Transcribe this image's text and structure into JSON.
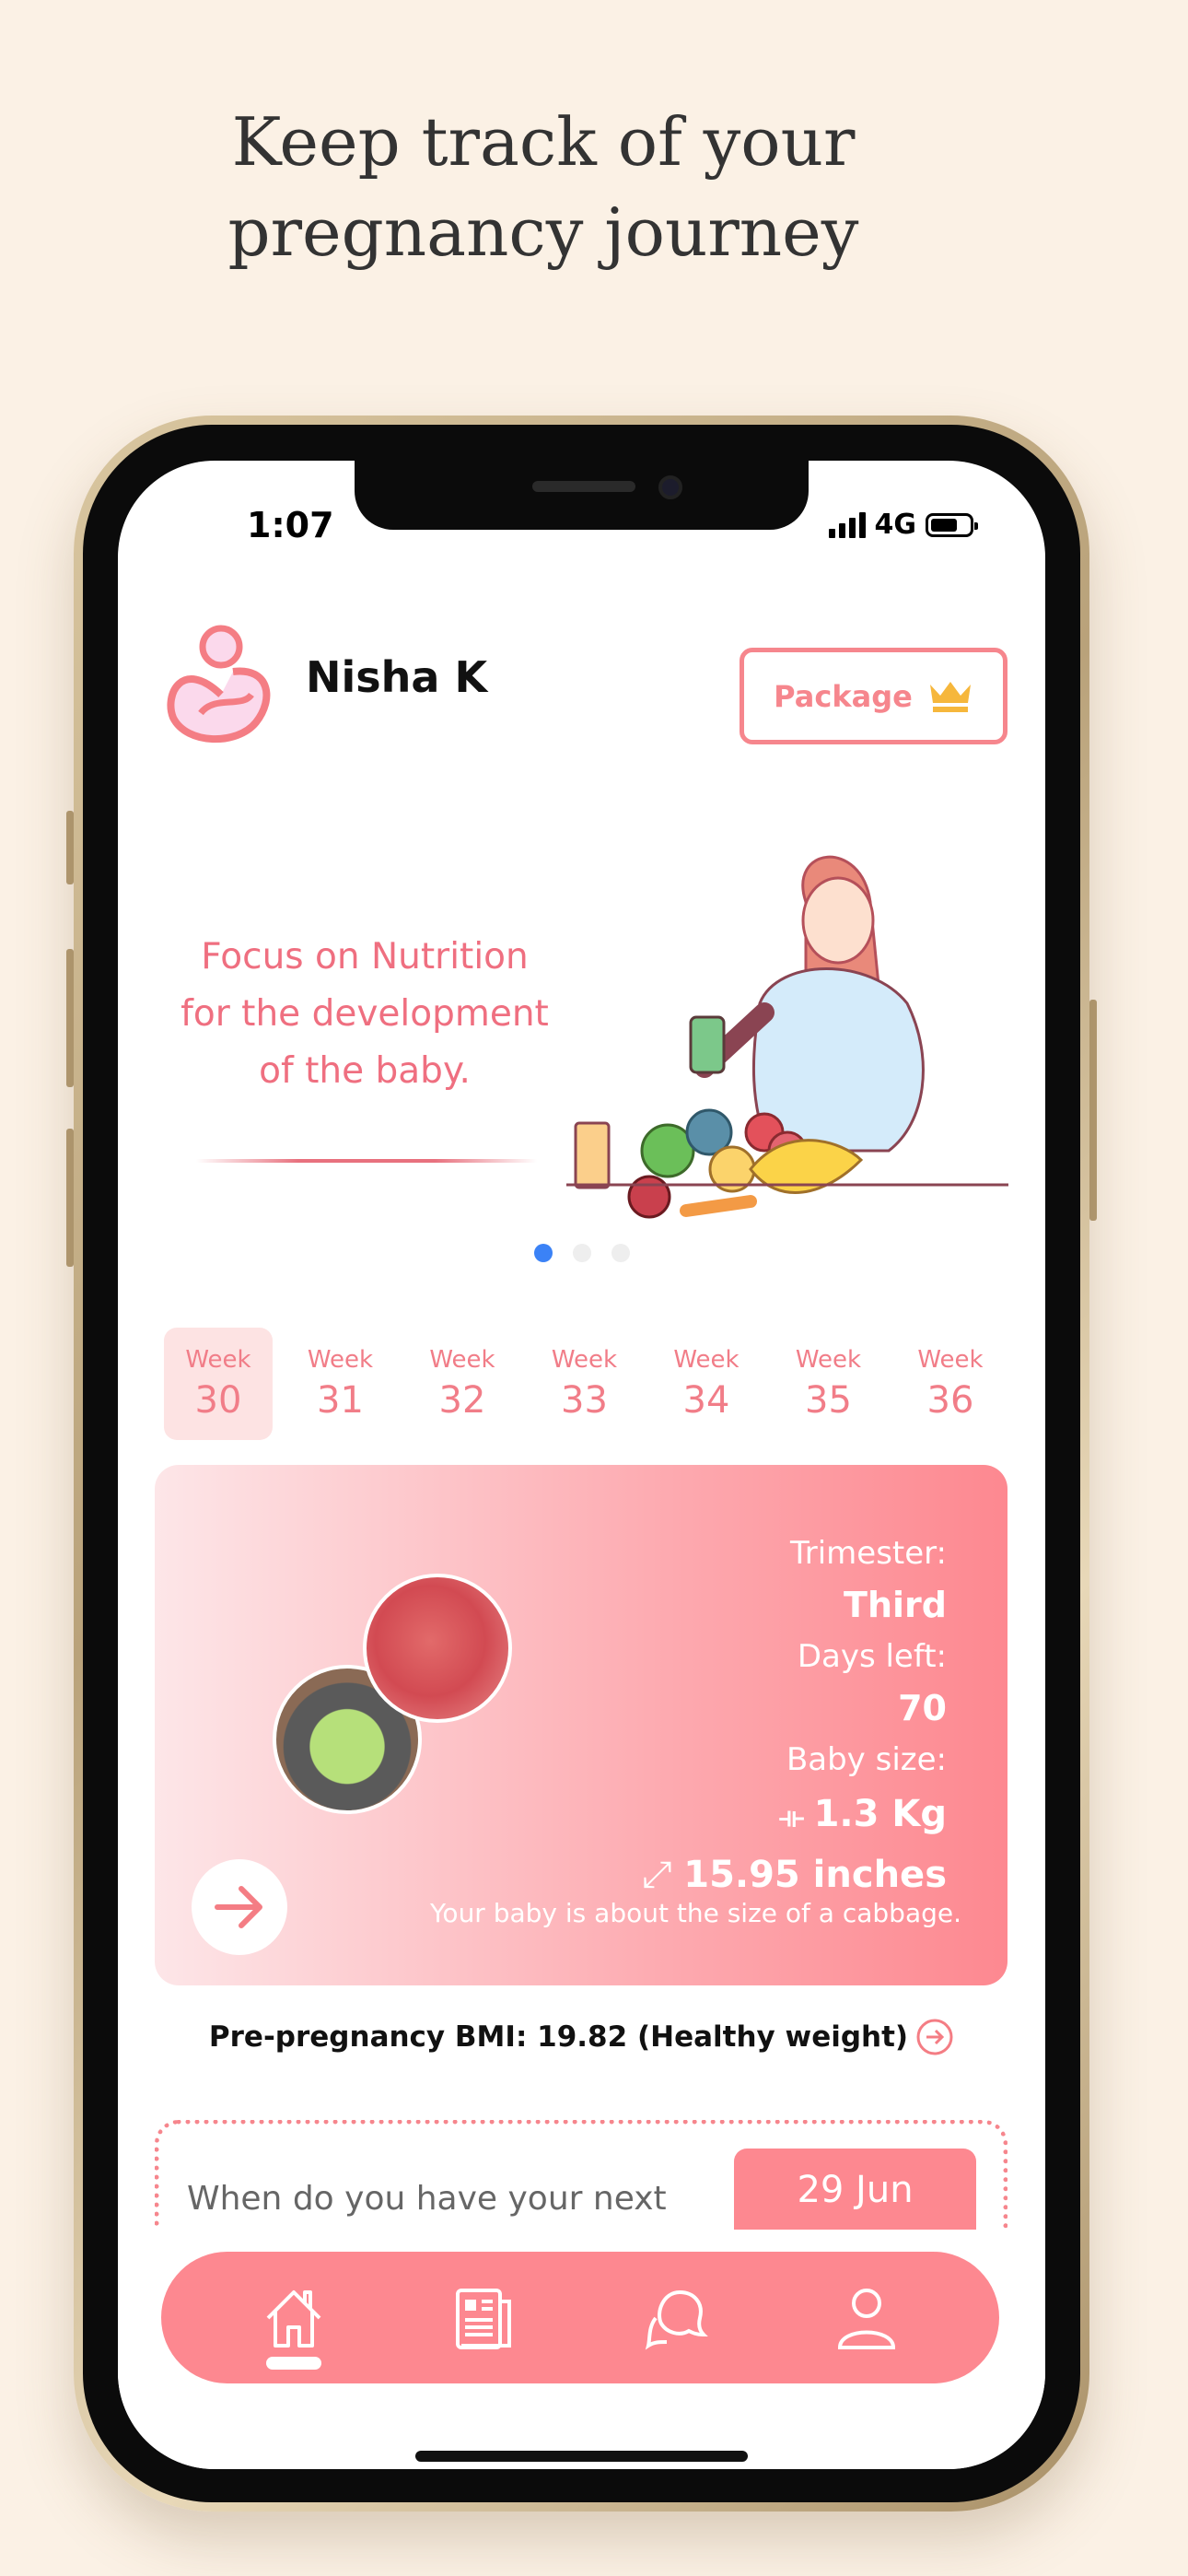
{
  "headline": [
    "Keep track of your",
    "pregnancy journey"
  ],
  "status_bar": {
    "time": "1:07",
    "network": "4G"
  },
  "header": {
    "username": "Nisha K",
    "package_label": "Package"
  },
  "banner": {
    "text": "Focus on Nutrition for the development of the baby.",
    "pages": 3,
    "active_page": 1
  },
  "weeks": [
    {
      "label": "Week",
      "number": "30",
      "selected": true
    },
    {
      "label": "Week",
      "number": "31"
    },
    {
      "label": "Week",
      "number": "32"
    },
    {
      "label": "Week",
      "number": "33"
    },
    {
      "label": "Week",
      "number": "34"
    },
    {
      "label": "Week",
      "number": "35"
    },
    {
      "label": "Week",
      "number": "36"
    }
  ],
  "baby_card": {
    "trimester_label": "Trimester:",
    "trimester": "Third",
    "days_left_label": "Days left:",
    "days_left": "70",
    "baby_size_label": "Baby size:",
    "weight": "1.3 Kg",
    "length": "15.95 inches",
    "comparison": "Your baby is about the size of a cabbage."
  },
  "bmi": {
    "text": "Pre-pregnancy BMI: 19.82 (Healthy weight)"
  },
  "reminder": {
    "question": "When do you have your next",
    "date": "29 Jun"
  },
  "nav": [
    "home-icon",
    "news-icon",
    "chat-icon",
    "profile-icon"
  ],
  "colors": {
    "accent": "#fd8890",
    "background": "#fbf1e5",
    "crown": "#f6b73c"
  }
}
